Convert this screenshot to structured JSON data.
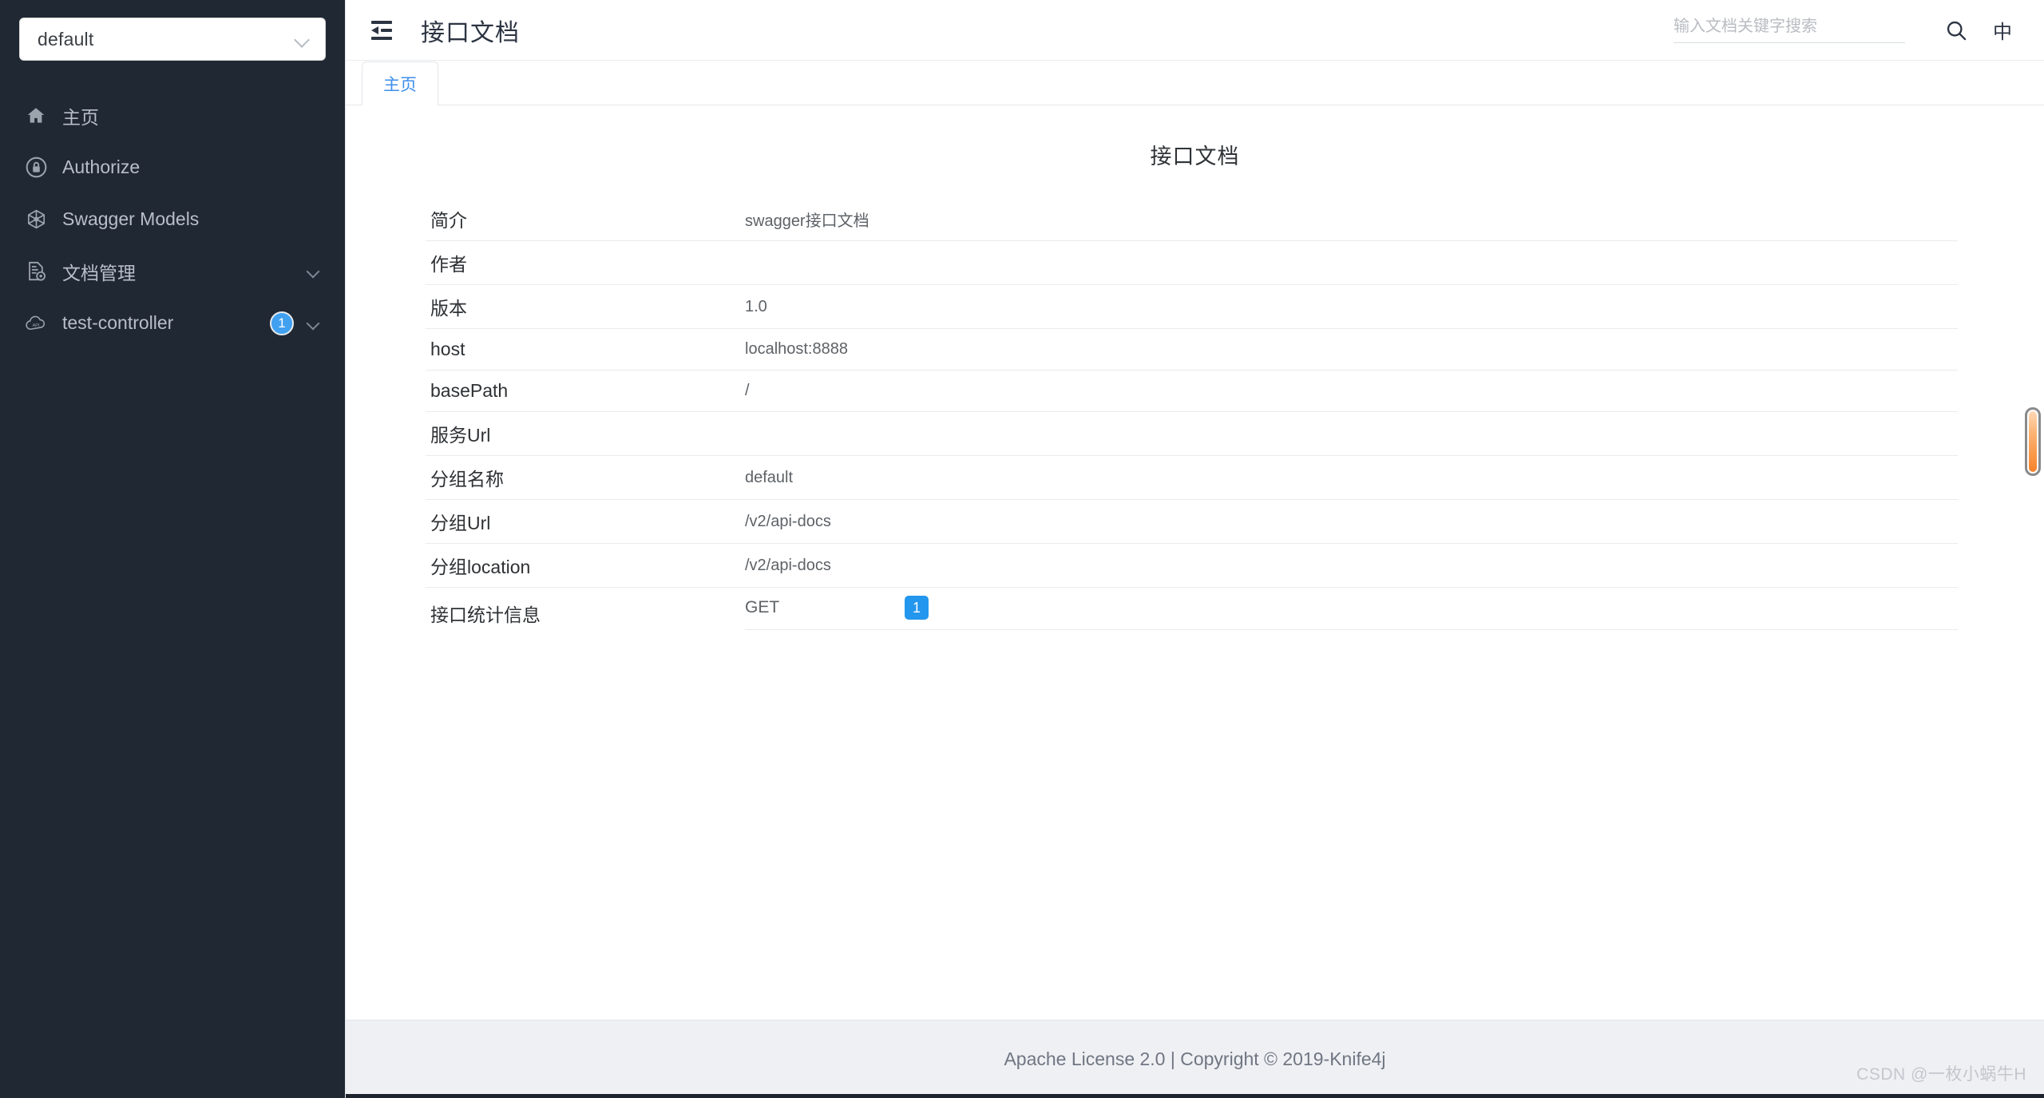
{
  "sidebar": {
    "group_select": {
      "value": "default",
      "icon": "chevron-down-icon"
    },
    "items": [
      {
        "label": "主页",
        "icon": "home-icon",
        "badge": null,
        "chevron": false
      },
      {
        "label": "Authorize",
        "icon": "lock-icon",
        "badge": null,
        "chevron": false
      },
      {
        "label": "Swagger Models",
        "icon": "cube-icon",
        "badge": null,
        "chevron": false
      },
      {
        "label": "文档管理",
        "icon": "document-settings-icon",
        "badge": null,
        "chevron": true
      },
      {
        "label": "test-controller",
        "icon": "api-cloud-icon",
        "badge": "1",
        "chevron": true
      }
    ]
  },
  "header": {
    "fold_icon": "menu-fold-icon",
    "title": "接口文档",
    "search": {
      "placeholder": "输入文档关键字搜索",
      "value": ""
    },
    "search_icon": "search-icon",
    "language_toggle": "中"
  },
  "tabs": [
    {
      "label": "主页",
      "active": true
    }
  ],
  "main": {
    "doc_title": "接口文档",
    "rows": [
      {
        "key": "简介",
        "value": "swagger接口文档"
      },
      {
        "key": "作者",
        "value": ""
      },
      {
        "key": "版本",
        "value": "1.0"
      },
      {
        "key": "host",
        "value": "localhost:8888"
      },
      {
        "key": "basePath",
        "value": "/"
      },
      {
        "key": "服务Url",
        "value": ""
      },
      {
        "key": "分组名称",
        "value": "default"
      },
      {
        "key": "分组Url",
        "value": "/v2/api-docs"
      },
      {
        "key": "分组location",
        "value": "/v2/api-docs"
      }
    ],
    "stats_row": {
      "key": "接口统计信息",
      "method": "GET",
      "count": "1"
    }
  },
  "footer": {
    "text": "Apache License 2.0 | Copyright © 2019-Knife4j"
  },
  "watermark": "CSDN @一枚小蜗牛H",
  "colors": {
    "sidebar_bg": "#202833",
    "accent_blue": "#2396ee",
    "tab_active": "#3c8eea",
    "footer_bg": "#eff0f4",
    "scrollbar_thumb": "#f8822b"
  }
}
